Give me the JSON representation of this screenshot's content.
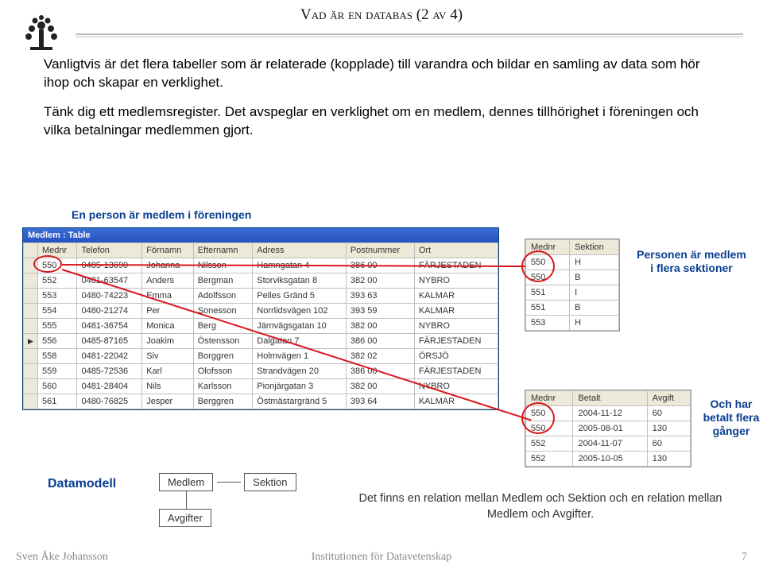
{
  "page": {
    "title": "Vad är en databas (2 av 4)"
  },
  "paras": {
    "p1": "Vanligtvis är det flera tabeller som är relaterade (kopplade) till varandra och bildar en samling av data som hör ihop och skapar en verklighet.",
    "p2": "Tänk dig ett medlemsregister. Det avspeglar en verklighet om en medlem, dennes tillhörighet i föreningen och vilka betalningar medlemmen gjort.",
    "sub": "En person är medlem i föreningen"
  },
  "medlem": {
    "winTitle": "Medlem : Table",
    "cols": [
      "Mednr",
      "Telefon",
      "Förnamn",
      "Efternamn",
      "Adress",
      "Postnummer",
      "Ort"
    ],
    "rows": [
      {
        "mark": false,
        "c": [
          "550",
          "0485-13690",
          "Johanna",
          "Nilsson",
          "Hamngatan 4",
          "386 00",
          "FÄRJESTADEN"
        ]
      },
      {
        "mark": false,
        "c": [
          "552",
          "0481-63547",
          "Anders",
          "Bergman",
          "Storviksgatan 8",
          "382 00",
          "NYBRO"
        ]
      },
      {
        "mark": false,
        "c": [
          "553",
          "0480-74223",
          "Emma",
          "Adolfsson",
          "Pelles Gränd 5",
          "393 63",
          "KALMAR"
        ]
      },
      {
        "mark": false,
        "c": [
          "554",
          "0480-21274",
          "Per",
          "Sonesson",
          "Norrlidsvägen 102",
          "393 59",
          "KALMAR"
        ]
      },
      {
        "mark": false,
        "c": [
          "555",
          "0481-36754",
          "Monica",
          "Berg",
          "Järnvägsgatan 10",
          "382 00",
          "NYBRO"
        ]
      },
      {
        "mark": true,
        "c": [
          "556",
          "0485-87165",
          "Joakim",
          "Östensson",
          "Dalgatan 7",
          "386 00",
          "FÄRJESTADEN"
        ]
      },
      {
        "mark": false,
        "c": [
          "558",
          "0481-22042",
          "Siv",
          "Borggren",
          "Holmvägen 1",
          "382 02",
          "ÖRSJÖ"
        ]
      },
      {
        "mark": false,
        "c": [
          "559",
          "0485-72536",
          "Karl",
          "Olofsson",
          "Strandvägen 20",
          "386 00",
          "FÄRJESTADEN"
        ]
      },
      {
        "mark": false,
        "c": [
          "560",
          "0481-28404",
          "Nils",
          "Karlsson",
          "Pionjärgatan 3",
          "382 00",
          "NYBRO"
        ]
      },
      {
        "mark": false,
        "c": [
          "561",
          "0480-76825",
          "Jesper",
          "Berggren",
          "Östmästargränd 5",
          "393 64",
          "KALMAR"
        ]
      }
    ]
  },
  "sektion": {
    "cols": [
      "Mednr",
      "Sektion"
    ],
    "rows": [
      [
        "550",
        "H"
      ],
      [
        "550",
        "B"
      ],
      [
        "551",
        "I"
      ],
      [
        "551",
        "B"
      ],
      [
        "553",
        "H"
      ]
    ]
  },
  "avgift": {
    "cols": [
      "Mednr",
      "Betalt",
      "Avgift"
    ],
    "rows": [
      [
        "550",
        "2004-11-12",
        "60"
      ],
      [
        "550",
        "2005-08-01",
        "130"
      ],
      [
        "552",
        "2004-11-07",
        "60"
      ],
      [
        "552",
        "2005-10-05",
        "130"
      ]
    ]
  },
  "callouts": {
    "c1": "Personen är medlem i flera sektioner",
    "c2": "Och har betalt flera gånger"
  },
  "datamodel": {
    "label": "Datamodell",
    "box1": "Medlem",
    "box2": "Sektion",
    "box3": "Avgifter",
    "relText": "Det finns en relation mellan Medlem och Sektion och en relation mellan Medlem och Avgifter."
  },
  "footer": {
    "left": "Sven Åke Johansson",
    "mid": "Institutionen för Datavetenskap",
    "right": "7"
  }
}
